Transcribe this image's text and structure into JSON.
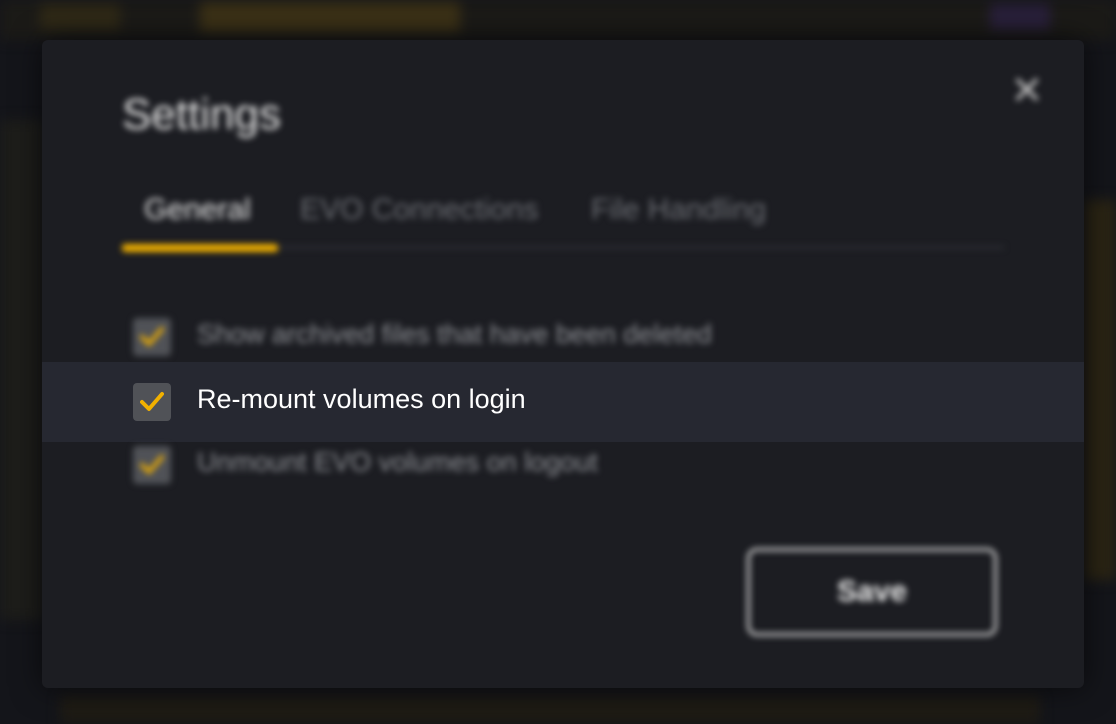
{
  "dialog": {
    "title": "Settings",
    "close_icon": "close-icon",
    "tabs": [
      {
        "label": "General",
        "active": true
      },
      {
        "label": "EVO Connections",
        "active": false
      },
      {
        "label": "File Handling",
        "active": false
      }
    ],
    "options": [
      {
        "label": "Show archived files that have been deleted",
        "checked": true
      },
      {
        "label": "Re-mount volumes on login",
        "checked": true
      },
      {
        "label": "Unmount EVO volumes on logout",
        "checked": true
      }
    ],
    "save_label": "Save"
  },
  "colors": {
    "accent": "#f2b100",
    "dialog_bg": "#1c1d22",
    "highlight_bg": "#262831"
  }
}
